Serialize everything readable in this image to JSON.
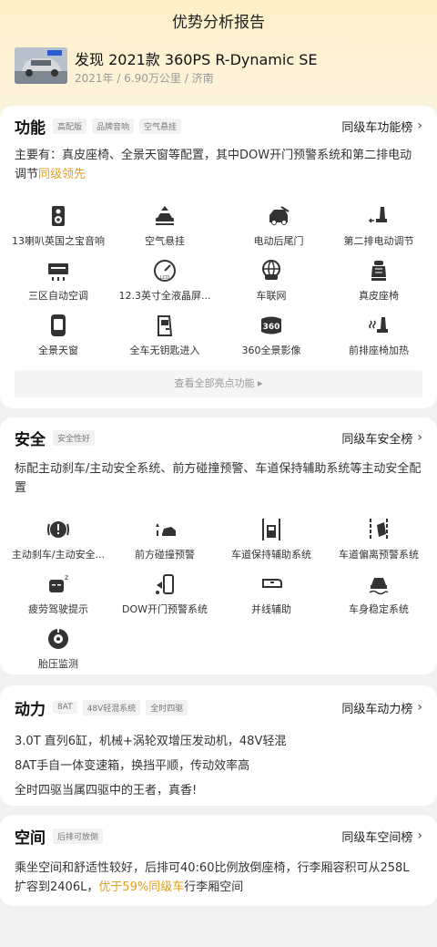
{
  "header": {
    "title": "优势分析报告"
  },
  "car": {
    "name": "发现 2021款 360PS R-Dynamic SE",
    "meta": "2021年 / 6.90万公里 / 济南"
  },
  "function": {
    "title": "功能",
    "tags": [
      "高配版",
      "品牌音响",
      "空气悬挂"
    ],
    "rank_link": "同级车功能榜",
    "desc_main": "主要有：真皮座椅、全景天窗等配置，其中DOW开门预警系统和第二排电动调节",
    "desc_highlight": "同级领先",
    "features": [
      {
        "icon": "speaker-icon",
        "label": "13喇叭英国之宝音响"
      },
      {
        "icon": "air-suspension-icon",
        "label": "空气悬挂"
      },
      {
        "icon": "power-tailgate-icon",
        "label": "电动后尾门"
      },
      {
        "icon": "seat-adjust-icon",
        "label": "第二排电动调节"
      },
      {
        "icon": "climate-control-icon",
        "label": "三区自动空调"
      },
      {
        "icon": "lcd-gauge-icon",
        "label": "12.3英寸全液晶屏..."
      },
      {
        "icon": "connected-car-icon",
        "label": "车联网"
      },
      {
        "icon": "leather-seat-icon",
        "label": "真皮座椅"
      },
      {
        "icon": "sunroof-icon",
        "label": "全景天窗"
      },
      {
        "icon": "keyless-entry-icon",
        "label": "全车无钥匙进入"
      },
      {
        "icon": "camera-360-icon",
        "label": "360全景影像"
      },
      {
        "icon": "seat-heating-icon",
        "label": "前排座椅加热"
      }
    ],
    "more_button": "查看全部亮点功能 ▸"
  },
  "safety": {
    "title": "安全",
    "tags": [
      "安全性好"
    ],
    "rank_link": "同级车安全榜",
    "desc": "标配主动刹车/主动安全系统、前方碰撞预警、车道保持辅助系统等主动安全配置",
    "features": [
      {
        "icon": "active-brake-icon",
        "label": "主动刹车/主动安全..."
      },
      {
        "icon": "collision-warning-icon",
        "label": "前方碰撞预警"
      },
      {
        "icon": "lane-keep-icon",
        "label": "车道保持辅助系统"
      },
      {
        "icon": "lane-departure-icon",
        "label": "车道偏离预警系统"
      },
      {
        "icon": "fatigue-icon",
        "label": "疲劳驾驶提示"
      },
      {
        "icon": "dow-warning-icon",
        "label": "DOW开门预警系统"
      },
      {
        "icon": "lane-change-assist-icon",
        "label": "并线辅助"
      },
      {
        "icon": "stability-icon",
        "label": "车身稳定系统"
      },
      {
        "icon": "tire-pressure-icon",
        "label": "胎压监测"
      }
    ]
  },
  "power": {
    "title": "动力",
    "tags": [
      "8AT",
      "48V轻混系统",
      "全时四驱"
    ],
    "rank_link": "同级车动力榜",
    "lines": [
      "3.0T 直列6缸，机械+涡轮双增压发动机，48V轻混",
      "8AT手自一体变速箱，换挡平顺，传动效率高",
      "全时四驱当属四驱中的王者，真香!"
    ]
  },
  "space": {
    "title": "空间",
    "tags": [
      "后排可放倒"
    ],
    "rank_link": "同级车空间榜",
    "desc_line1": "乘坐空间和舒适性较好，后排可40:60比例放倒座椅，行李厢容积可从258L",
    "desc_line2_a": "扩容到2406L，",
    "desc_line2_hl": "优于59%同级车",
    "desc_line2_b": "行李厢空间"
  },
  "colors": {
    "accent": "#e0a020",
    "hero_bg": "#fdefc7"
  }
}
